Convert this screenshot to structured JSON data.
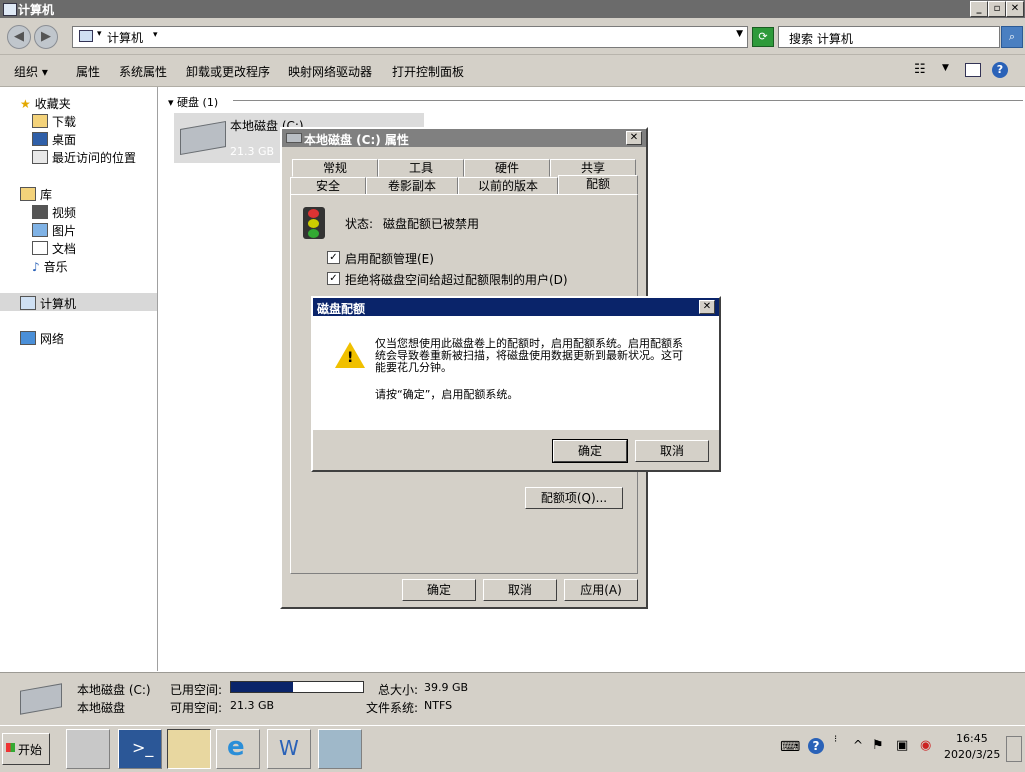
{
  "window": {
    "title": "计算机"
  },
  "address": {
    "path": "计算机",
    "search_placeholder": "搜索 计算机"
  },
  "toolbar": {
    "organize": "组织",
    "properties": "属性",
    "system_properties": "系统属性",
    "uninstall": "卸载或更改程序",
    "map_drive": "映射网络驱动器",
    "control_panel": "打开控制面板"
  },
  "nav": {
    "favorites": "收藏夹",
    "downloads": "下载",
    "desktop": "桌面",
    "recent": "最近访问的位置",
    "libraries": "库",
    "videos": "视频",
    "pictures": "图片",
    "documents": "文档",
    "music": "音乐",
    "computer": "计算机",
    "network": "网络"
  },
  "content": {
    "group_header": "硬盘 (1)",
    "drive_name": "本地磁盘 (C:)",
    "drive_free": "21.3 GB"
  },
  "props_dialog": {
    "title": "本地磁盘 (C:) 属性",
    "tabs_row1": [
      "常规",
      "工具",
      "硬件",
      "共享"
    ],
    "tabs_row2": [
      "安全",
      "卷影副本",
      "以前的版本",
      "配额"
    ],
    "status_label": "状态:",
    "status_value": "磁盘配额已被禁用",
    "enable_quota": "启用配额管理(E)",
    "deny_space": "拒绝将磁盘空间给超过配额限制的用户(D)",
    "quota_entries": "配额项(Q)...",
    "ok": "确定",
    "cancel": "取消",
    "apply": "应用(A)"
  },
  "quota_dialog": {
    "title": "磁盘配额",
    "message": "仅当您想使用此磁盘卷上的配额时，启用配额系统。启用配额系统会导致卷重新被扫描，将磁盘使用数据更新到最新状况。这可能要花几分钟。",
    "prompt": "请按“确定”，启用配额系统。",
    "ok": "确定",
    "cancel": "取消"
  },
  "details": {
    "name": "本地磁盘 (C:)",
    "type": "本地磁盘",
    "used_label": "已用空间:",
    "free_label": "可用空间:",
    "free_value": "21.3 GB",
    "total_label": "总大小:",
    "total_value": "39.9 GB",
    "fs_label": "文件系统:",
    "fs_value": "NTFS",
    "used_fraction": 0.47
  },
  "taskbar": {
    "start": "开始",
    "time": "16:45",
    "date": "2020/3/25"
  },
  "colors": {
    "dialog_title_active": "#0a246a",
    "dialog_title_inactive": "#808080",
    "usage_bar": "#0a246a"
  }
}
